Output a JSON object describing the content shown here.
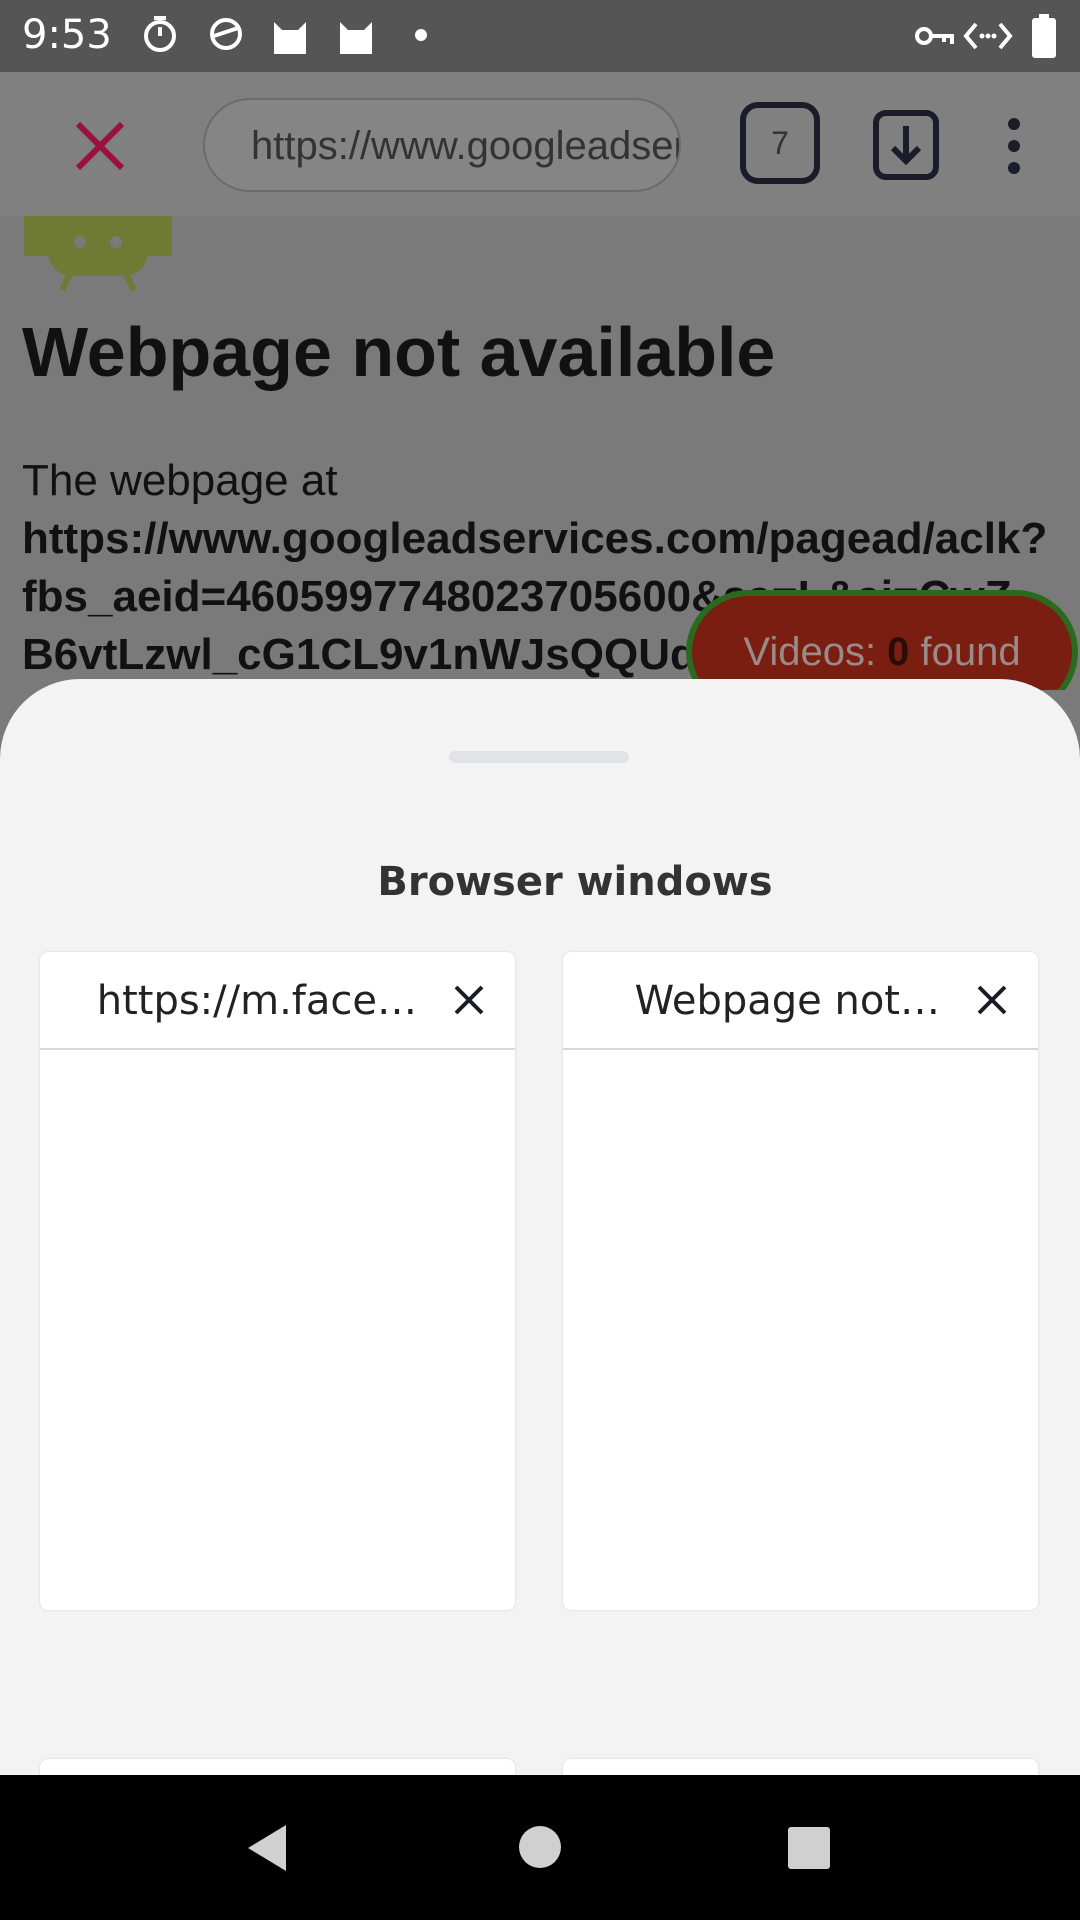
{
  "status_bar": {
    "time": "9:53",
    "left_icons": [
      "timer-icon",
      "sync-icon",
      "cat-icon",
      "cat-icon",
      "dot-icon"
    ],
    "right_icons": [
      "vpn-key-icon",
      "data-arrows-icon",
      "battery-icon"
    ]
  },
  "toolbar": {
    "url": "https://www.googleadservices.com/pagead/aclk",
    "tab_count": "7",
    "icons": [
      "close-icon",
      "download-icon",
      "more-vert-icon"
    ]
  },
  "page": {
    "heading": "Webpage not available",
    "intro": "The webpage at",
    "url_lines": [
      "https://www.googleadservices.com/pagead/aclk?",
      "fbs_aeid=4605997748023705600&sa=L&ai=CwZ",
      "B6vtLzwl_cG1CL9v1nWJsQQUd-"
    ],
    "videos_prefix": "Videos: ",
    "videos_count": "0",
    "videos_suffix": " found"
  },
  "sheet": {
    "title": "Browser windows",
    "windows": [
      {
        "title": "https://m.face…"
      },
      {
        "title": "Webpage not…"
      }
    ]
  },
  "colors": {
    "close_accent": "#9a1040",
    "videos_pill": "#7a1e12",
    "videos_border": "#2a6a1e",
    "android_green": "#7a8a2a"
  }
}
